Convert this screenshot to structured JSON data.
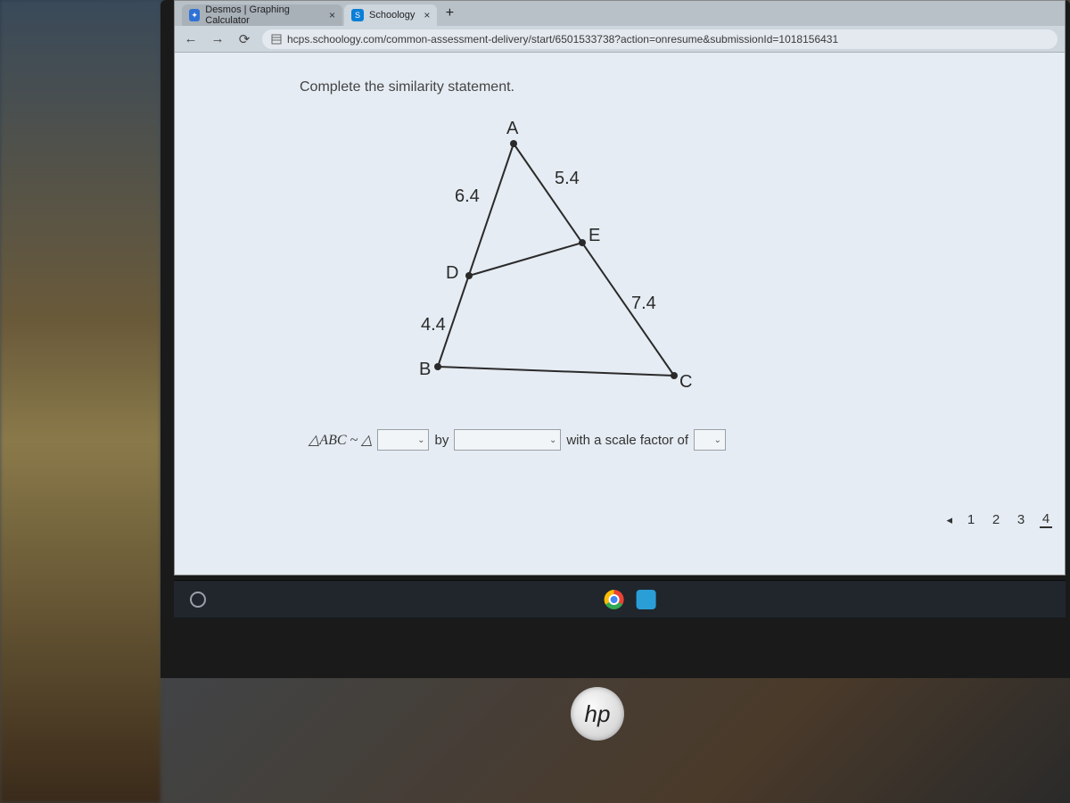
{
  "tabs": [
    {
      "title": "Desmos | Graphing Calculator",
      "favicon": "desmos"
    },
    {
      "title": "Schoology",
      "favicon": "schoology"
    }
  ],
  "url": "hcps.schoology.com/common-assessment-delivery/start/6501533738?action=onresume&submissionId=1018156431",
  "question": {
    "prompt": "Complete the similarity statement.",
    "labels": {
      "A": "A",
      "B": "B",
      "C": "C",
      "D": "D",
      "E": "E",
      "AD": "6.4",
      "AE": "5.4",
      "DB": "4.4",
      "EC": "7.4"
    },
    "answer_prefix": "△ABC ~ △",
    "by": "by",
    "scale_text": "with a scale factor of"
  },
  "pager": {
    "prev": "◂",
    "pages": [
      "1",
      "2",
      "3",
      "4"
    ],
    "active": 3
  },
  "brand": "hp"
}
